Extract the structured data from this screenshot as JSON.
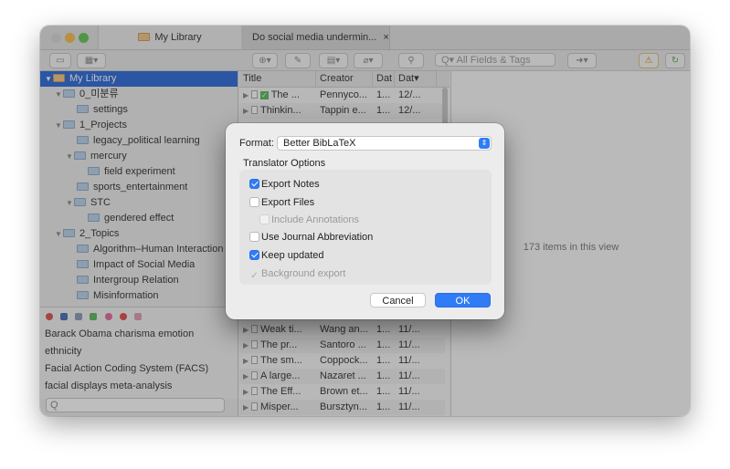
{
  "window": {
    "tabs": [
      {
        "label": "My Library"
      },
      {
        "label": "Do social media undermin...",
        "close": "×"
      }
    ]
  },
  "toolbar": {
    "search_placeholder": "All Fields & Tags",
    "search_prefix": "Q▾"
  },
  "library": {
    "root": "My Library",
    "items": [
      {
        "label": "0_미분류"
      },
      {
        "label": "settings"
      },
      {
        "label": "1_Projects"
      },
      {
        "label": "legacy_political learning"
      },
      {
        "label": "mercury"
      },
      {
        "label": "field experiment"
      },
      {
        "label": "sports_entertainment"
      },
      {
        "label": "STC"
      },
      {
        "label": "gendered effect"
      },
      {
        "label": "2_Topics"
      },
      {
        "label": "Algorithm–Human Interaction"
      },
      {
        "label": "Impact of Social Media"
      },
      {
        "label": "Intergroup Relation"
      },
      {
        "label": "Misinformation"
      }
    ]
  },
  "tags": {
    "lines": [
      "Barack Obama  charisma  emotion",
      "ethnicity",
      "Facial Action Coding System (FACS)",
      "facial displays  meta-analysis"
    ],
    "search_placeholder": "Q"
  },
  "items_table": {
    "columns": [
      "Title",
      "Creator",
      "Dat",
      "Dat▾"
    ],
    "rows_top": [
      {
        "title": "The ...",
        "creator": "Pennyco...",
        "d1": "1...",
        "d2": "12/..."
      },
      {
        "title": "Thinkin...",
        "creator": "Tappin e...",
        "d1": "1...",
        "d2": "12/..."
      }
    ],
    "rows_bottom": [
      {
        "title": "Weak ti...",
        "creator": "Wang an...",
        "d1": "1...",
        "d2": "11/..."
      },
      {
        "title": "The pr...",
        "creator": "Santoro ...",
        "d1": "1...",
        "d2": "11/..."
      },
      {
        "title": "The sm...",
        "creator": "Coppock...",
        "d1": "1...",
        "d2": "11/..."
      },
      {
        "title": "A large...",
        "creator": "Nazaret ...",
        "d1": "1...",
        "d2": "11/..."
      },
      {
        "title": "The Eff...",
        "creator": "Brown et...",
        "d1": "1...",
        "d2": "11/..."
      },
      {
        "title": "Misper...",
        "creator": "Bursztyn...",
        "d1": "1...",
        "d2": "11/..."
      }
    ]
  },
  "item_pane": {
    "message": "173 items in this view"
  },
  "dialog": {
    "format_label": "Format:",
    "format_value": "Better BibLaTeX",
    "section_title": "Translator Options",
    "options": [
      {
        "label": "Export Notes",
        "checked": true
      },
      {
        "label": "Export Files",
        "checked": false
      },
      {
        "label": "Include Annotations",
        "checked": false,
        "disabled": true
      },
      {
        "label": "Use Journal Abbreviation",
        "checked": false
      },
      {
        "label": "Keep updated",
        "checked": true
      },
      {
        "label": "Background export",
        "checked": true,
        "disabled": true
      }
    ],
    "cancel_label": "Cancel",
    "ok_label": "OK"
  },
  "colors": {
    "accent": "#2f7cf6",
    "selection": "#2c6ad9"
  }
}
